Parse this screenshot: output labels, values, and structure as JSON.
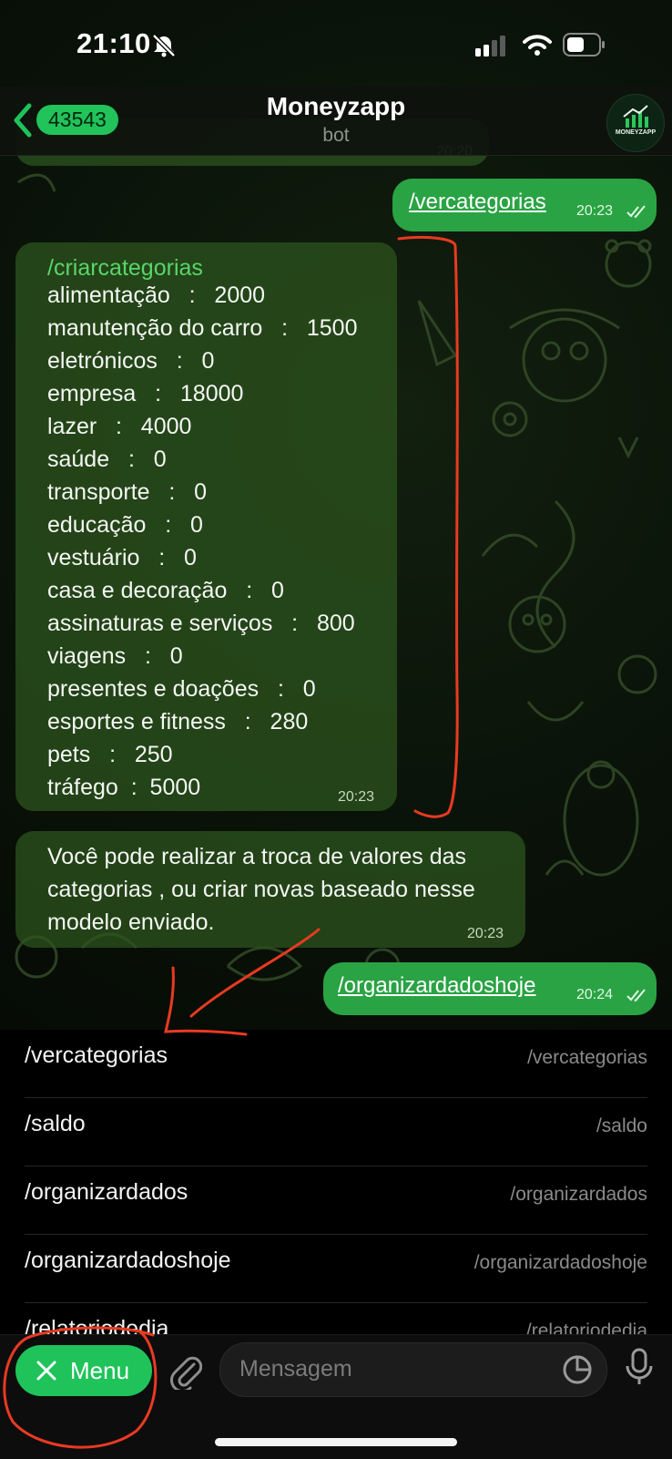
{
  "status_bar": {
    "time": "21:10"
  },
  "header": {
    "back_count": "43543",
    "title": "Moneyzapp",
    "subtitle": "bot",
    "avatar_label": "MONEYZAPP"
  },
  "partial_top": {
    "time": "20:20"
  },
  "msg_out_1": {
    "text": "/vercategorias",
    "time": "20:23"
  },
  "categories_msg": {
    "link": "/criarcategorias",
    "lines": [
      "alimentação   :   2000",
      "manutenção do carro   :   1500",
      "eletrónicos   :   0",
      "empresa   :   18000",
      "lazer   :   4000",
      "saúde   :   0",
      "transporte   :   0",
      "educação   :   0",
      "vestuário   :   0",
      "casa e decoração   :   0",
      "assinaturas e serviços   :   800",
      "viagens   :   0",
      "presentes e doações   :   0",
      "esportes e fitness   :   280",
      "pets   :   250",
      "tráfego  :  5000"
    ],
    "time": "20:23"
  },
  "info_msg": {
    "text": "Você pode realizar a troca de valores das categorias , ou criar novas baseado nesse modelo enviado.",
    "time": "20:23"
  },
  "msg_out_2": {
    "text": "/organizardadoshoje",
    "time": "20:24"
  },
  "commands": [
    {
      "command": "/vercategorias",
      "description": "/vercategorias"
    },
    {
      "command": "/saldo",
      "description": "/saldo"
    },
    {
      "command": "/organizardados",
      "description": "/organizardados"
    },
    {
      "command": "/organizardadoshoje",
      "description": "/organizardadoshoje"
    },
    {
      "command": "/relatoriodedia",
      "description": "/relatoriodedia"
    }
  ],
  "input_bar": {
    "menu_label": "Menu",
    "placeholder": "Mensagem"
  },
  "colors": {
    "accent": "#1fc35a",
    "outgoing_bubble": "#2aa344",
    "annotation": "#e83a22"
  }
}
